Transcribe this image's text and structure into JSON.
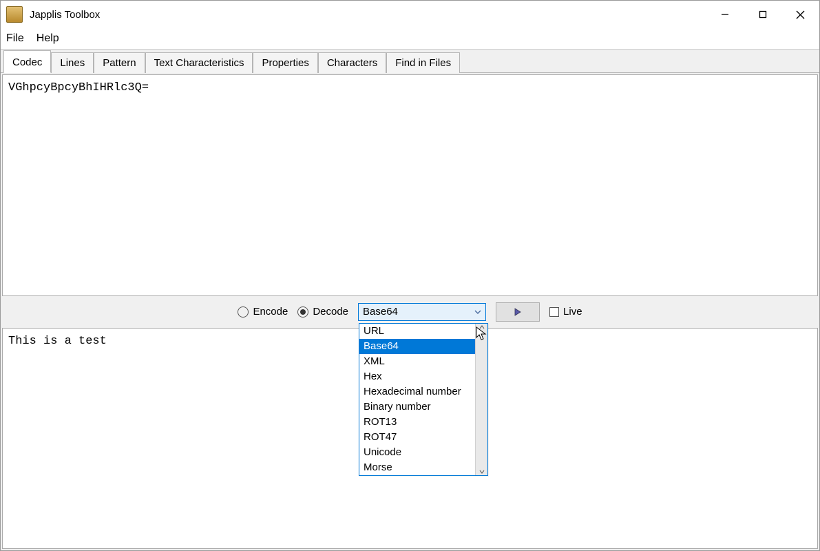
{
  "window": {
    "title": "Japplis Toolbox"
  },
  "menubar": {
    "items": [
      "File",
      "Help"
    ]
  },
  "tabs": {
    "items": [
      "Codec",
      "Lines",
      "Pattern",
      "Text Characteristics",
      "Properties",
      "Characters",
      "Find in Files"
    ],
    "active_index": 0
  },
  "codec": {
    "input_text": "VGhpcyBpcyBhIHRlc3Q=",
    "output_text": "This is a test",
    "encode_label": "Encode",
    "decode_label": "Decode",
    "mode": "Decode",
    "live_label": "Live",
    "live_checked": false,
    "format_selected": "Base64",
    "format_options": [
      "URL",
      "Base64",
      "XML",
      "Hex",
      "Hexadecimal number",
      "Binary number",
      "ROT13",
      "ROT47",
      "Unicode",
      "Morse"
    ]
  }
}
